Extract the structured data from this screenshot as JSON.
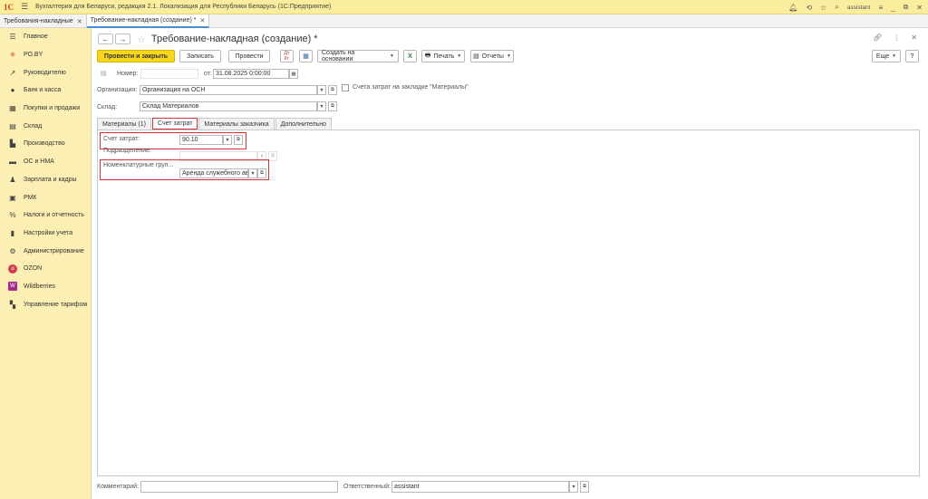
{
  "titlebar": {
    "logo": "1С",
    "app_title": "Бухгалтерия для Беларуси, редакция 2.1. Локализация для Республики Беларусь  (1С:Предприятие)",
    "user": "assistant"
  },
  "window_tabs": [
    {
      "label": "Требования-накладные"
    },
    {
      "label": "Требование-накладная (создание) *"
    }
  ],
  "sidebar": {
    "items": [
      {
        "label": "Главное"
      },
      {
        "label": "РО.BY"
      },
      {
        "label": "Руководителю"
      },
      {
        "label": "Банк и касса"
      },
      {
        "label": "Покупки и продажи"
      },
      {
        "label": "Склад"
      },
      {
        "label": "Производство"
      },
      {
        "label": "ОС и НМА"
      },
      {
        "label": "Зарплата и кадры"
      },
      {
        "label": "РМК"
      },
      {
        "label": "Налоги и отчетность"
      },
      {
        "label": "Настройки учета"
      },
      {
        "label": "Администрирование"
      },
      {
        "label": "OZON"
      },
      {
        "label": "Wildberries"
      },
      {
        "label": "Управление тарифом"
      }
    ]
  },
  "form": {
    "title": "Требование-накладная (создание) *",
    "toolbar": {
      "post_and_close": "Провести и закрыть",
      "save": "Записать",
      "post": "Провести",
      "create_based_on": "Создать на основании",
      "print": "Печать",
      "reports": "Отчеты",
      "more": "Еще",
      "help": "?"
    },
    "fields": {
      "number_label": "Номер:",
      "number_value": "",
      "date_label": "от:",
      "date_value": "31.08.2025  0:00:00",
      "organization_label": "Организация:",
      "organization_value": "Организация на ОСН",
      "cost_accounts_checkbox": "Счета затрат на закладке \"Материалы\"",
      "warehouse_label": "Склад:",
      "warehouse_value": "Склад Материалов"
    },
    "tabs": [
      {
        "label": "Материалы (1)"
      },
      {
        "label": "Счет затрат"
      },
      {
        "label": "Материалы заказчика"
      },
      {
        "label": "Дополнительно"
      }
    ],
    "cost_tab": {
      "account_label": "Счет затрат:",
      "account_value": "90.10",
      "division_label": "Подразделение:",
      "division_value": "",
      "nomenclature_group_label": "Номенклатурные груп...",
      "nomenclature_group_value": "Аренда служебного автомобиля"
    },
    "footer": {
      "comment_label": "Комментарий:",
      "comment_value": "",
      "responsible_label": "Ответственный:",
      "responsible_value": "assistant"
    }
  }
}
